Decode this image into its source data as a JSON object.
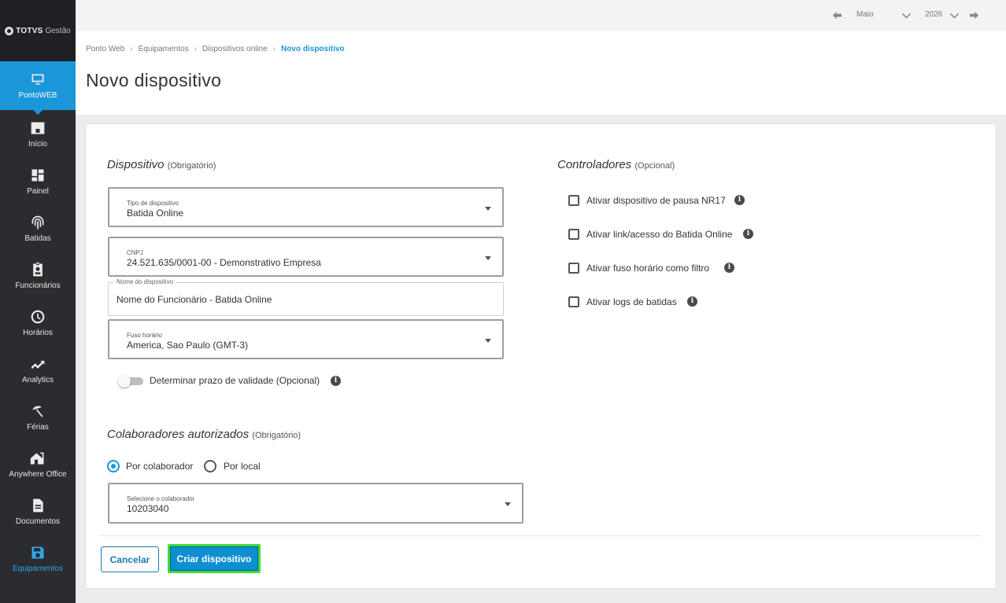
{
  "sidebar": {
    "logo_brand": "TOTVS",
    "logo_product": "Gestão",
    "items": [
      {
        "label": "PontoWEB",
        "icon": "monitor-icon"
      },
      {
        "label": "Início",
        "icon": "home-icon"
      },
      {
        "label": "Painel",
        "icon": "dashboard-icon"
      },
      {
        "label": "Batidas",
        "icon": "fingerprint-icon"
      },
      {
        "label": "Funcionários",
        "icon": "id-badge-icon"
      },
      {
        "label": "Horários",
        "icon": "clock-icon"
      },
      {
        "label": "Analytics",
        "icon": "trending-up-icon"
      },
      {
        "label": "Férias",
        "icon": "beach-umbrella-icon"
      },
      {
        "label": "Anywhere Office",
        "icon": "home-office-icon"
      },
      {
        "label": "Documentos",
        "icon": "document-icon"
      },
      {
        "label": "Equipamentos",
        "icon": "device-icon"
      }
    ]
  },
  "topbar": {
    "month": "Maio",
    "year": "2026"
  },
  "breadcrumb": {
    "items": [
      "Ponto Web",
      "Equipamentos",
      "Dispositivos online",
      "Novo dispositivo"
    ]
  },
  "page": {
    "title": "Novo dispositivo"
  },
  "dispositivo": {
    "title": "Dispositivo",
    "requirement": "(Obrigatório)",
    "tipo_label": "Tipo de dispositivo",
    "tipo_value": "Batida Online",
    "cnpj_label": "CNPJ",
    "cnpj_value": "24.521.635/0001-00 - Demonstrativo Empresa",
    "nome_label": "Nome do dispositivo",
    "nome_value": "Nome do Funcionário - Batida Online",
    "fuso_label": "Fuso horário",
    "fuso_value": "America, Sao Paulo (GMT-3)",
    "validade_label": "Determinar prazo de validade (Opcional)"
  },
  "controladores": {
    "title": "Controladores",
    "requirement": "(Opcional)",
    "options": [
      "Ativar dispositivo de pausa NR17",
      "Ativar link/acesso do Batida Online",
      "Ativar fuso horário como filtro",
      "Ativar logs de batidas"
    ]
  },
  "colaboradores": {
    "title": "Colaboradores autorizados",
    "requirement": "(Obrigatório)",
    "radio_por_colaborador": "Por colaborador",
    "radio_por_local": "Por local",
    "select_label": "Selecione o colaborador",
    "select_value": "10203040"
  },
  "actions": {
    "cancel": "Cancelar",
    "create": "Criar dispositivo"
  },
  "colors": {
    "accent": "#1b96d9",
    "sidebar": "#2b2c30",
    "focus_outline": "#3ddc3d"
  }
}
